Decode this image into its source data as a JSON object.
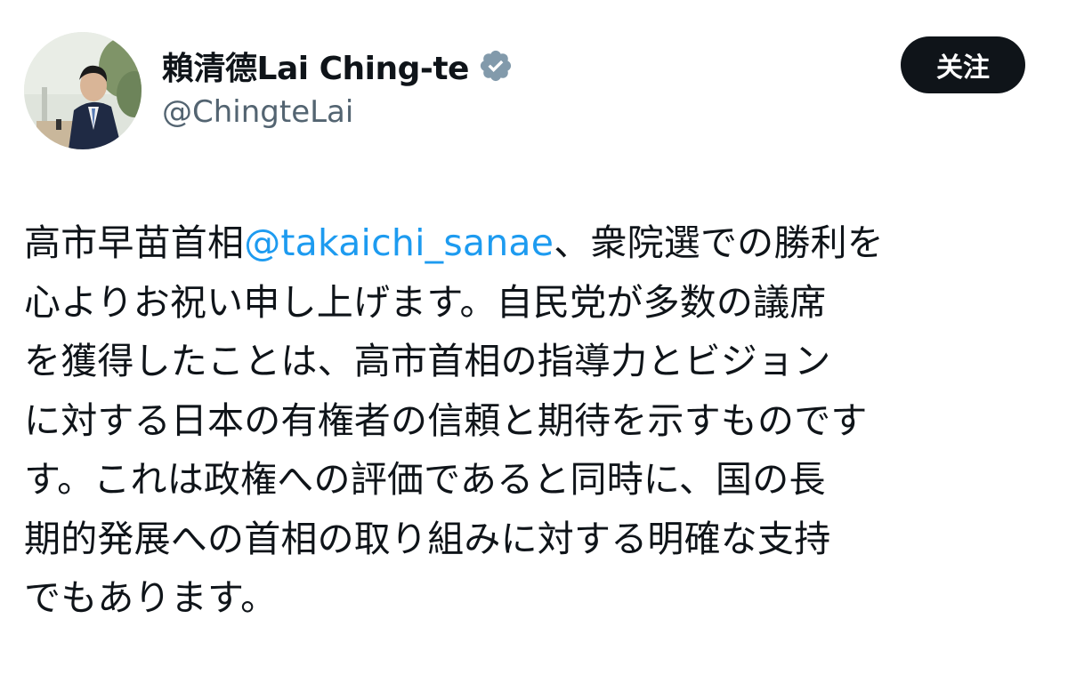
{
  "author": {
    "display_name": "賴清德Lai Ching-te",
    "handle": "@ChingteLai",
    "verified": true,
    "verified_badge_color": "#829aab",
    "avatar_icon": "profile-photo"
  },
  "actions": {
    "follow_label": "关注"
  },
  "tweet": {
    "lines": [
      {
        "before": "高市早苗首相",
        "mention": "@takaichi_sanae",
        "after": "、衆院選での勝利を"
      },
      {
        "text": "心よりお祝い申し上げます。自民党が多数の議席"
      },
      {
        "text": "を獲得したことは、高市首相の指導力とビジョン"
      },
      {
        "text": "に対する日本の有権者の信頼と期待を示すものです"
      },
      {
        "text": "す。これは政権への評価であると同時に、国の長"
      },
      {
        "text": "期的発展への首相の取り組みに対する明確な支持"
      },
      {
        "text": "でもあります。"
      }
    ]
  },
  "colors": {
    "text": "#0f1419",
    "secondary": "#536471",
    "mention": "#1d9bf0",
    "button_bg": "#0f1419",
    "button_text": "#ffffff"
  }
}
